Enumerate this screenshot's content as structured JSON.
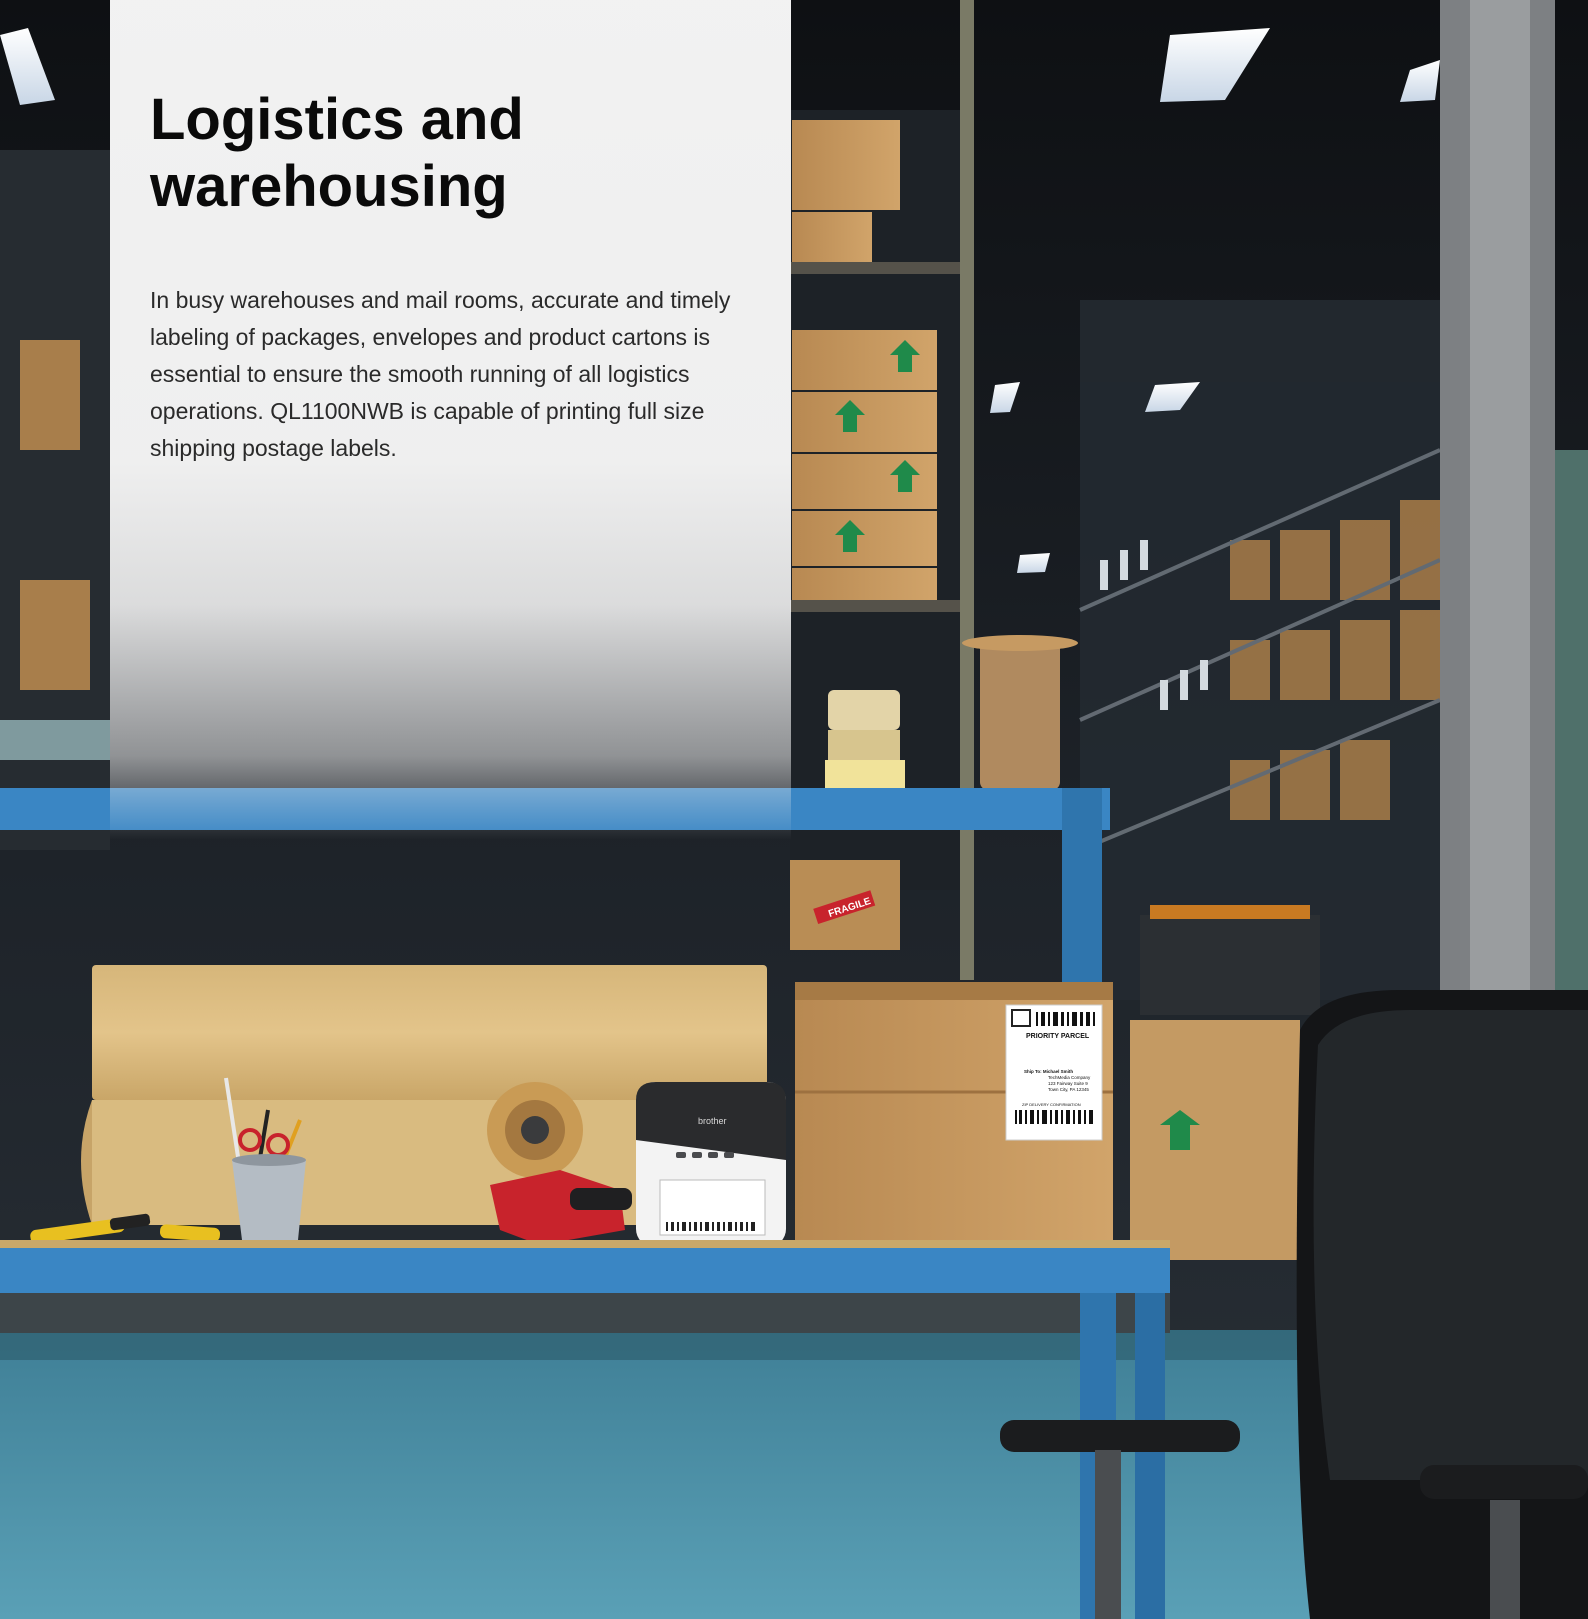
{
  "section": {
    "title": "Logistics and warehousing",
    "body": "In busy warehouses and mail rooms, accurate and timely labeling of packages, envelopes and product cartons is essential to ensure the smooth running of all logistics operations. QL1100NWB is capable of printing full size shipping postage labels."
  },
  "photo": {
    "printer_brand": "brother",
    "box_sticker": "FRAGILE",
    "label": {
      "service": "PRIORITY PARCEL",
      "ship_to": "Ship To: Michael Smith",
      "company": "TechMedia Company",
      "street": "123 Fairway Suite 9",
      "city": "Town City, PA 12345",
      "confirmation": "ZIP DELIVERY CONFIRMATION"
    }
  },
  "colors": {
    "bench_blue": "#3a86c4",
    "floor_teal": "#4a8fa6",
    "card_bg": "#f6f6f6",
    "title_color": "#0a0a0a",
    "body_color": "#2a2a2a"
  }
}
